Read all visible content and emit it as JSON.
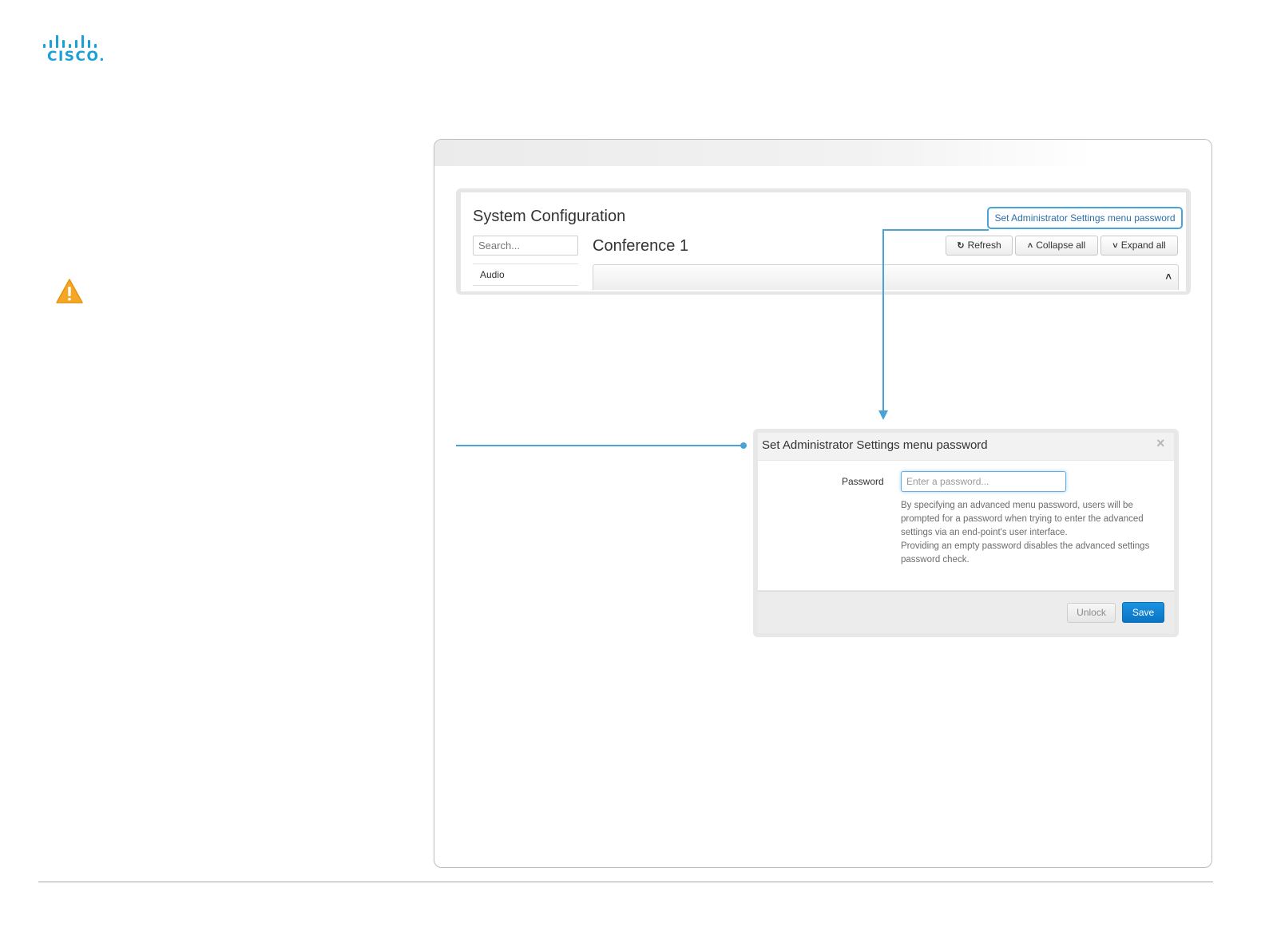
{
  "brand": {
    "logo_text": "CISCO.",
    "color": "#1ba0d7"
  },
  "config": {
    "page_title": "System Configuration",
    "search": {
      "placeholder": "Search...",
      "value": ""
    },
    "sidebar": {
      "items": [
        {
          "label": "Audio"
        }
      ]
    },
    "section_title": "Conference 1",
    "set_admin_link": "Set Administrator Settings menu password",
    "toolbar": {
      "refresh": "Refresh",
      "collapse_all": "Collapse all",
      "expand_all": "Expand all"
    }
  },
  "modal": {
    "title": "Set Administrator Settings menu password",
    "password_label": "Password",
    "password_placeholder": "Enter a password...",
    "password_value": "",
    "help_text_1": "By specifying an advanced menu password, users will be prompted for a password when trying to enter the advanced settings via an end-point's user interface.",
    "help_text_2": "Providing an empty password disables the advanced settings password check.",
    "unlock_label": "Unlock",
    "save_label": "Save"
  },
  "colors": {
    "accent": "#4aa3d8",
    "primary_button": "#0a74c4",
    "warning": "#f5a623"
  },
  "icons": [
    "cisco-logo",
    "warning-icon",
    "refresh-icon",
    "chevron-up-icon",
    "chevron-down-icon",
    "close-icon"
  ]
}
